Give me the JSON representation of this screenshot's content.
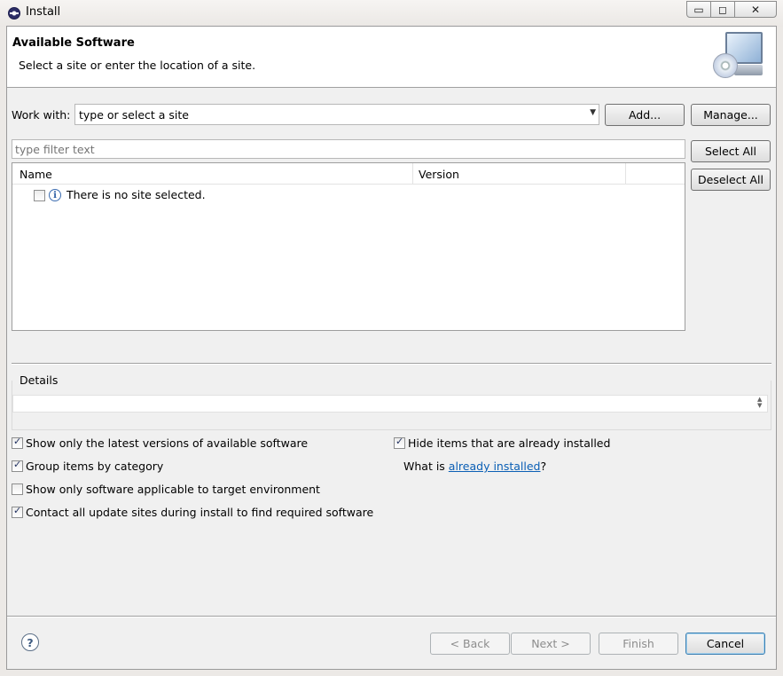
{
  "window": {
    "title": "Install",
    "min": "▭",
    "max": "◻",
    "close": "✕"
  },
  "header": {
    "title": "Available Software",
    "description": "Select a site or enter the location of a site."
  },
  "work_with": {
    "label": "Work with:",
    "value": "type or select a site",
    "add": "Add...",
    "manage": "Manage..."
  },
  "filter": {
    "placeholder": "type filter text"
  },
  "table": {
    "columns": [
      "Name",
      "Version"
    ],
    "rows": [
      {
        "name": "There is no site selected."
      }
    ]
  },
  "side_buttons": {
    "select_all": "Select All",
    "deselect_all": "Deselect All"
  },
  "details": {
    "label": "Details"
  },
  "options": {
    "latest_versions": {
      "label": "Show only the latest versions of available software",
      "checked": true
    },
    "group_by_category": {
      "label": "Group items by category",
      "checked": true
    },
    "target_env": {
      "label": "Show only software applicable to target environment",
      "checked": false
    },
    "contact_sites": {
      "label": "Contact all update sites during install to find required software",
      "checked": true
    },
    "hide_installed": {
      "label": "Hide items that are already installed",
      "checked": true
    },
    "what_is": "What is",
    "already_installed": "already installed",
    "question_mark": "?"
  },
  "footer": {
    "back": "< Back",
    "next": "Next >",
    "finish": "Finish",
    "cancel": "Cancel",
    "help": "?"
  },
  "colors": {
    "link": "#0b5fb5",
    "accent": "#3c7fb1"
  },
  "icons": [
    "eclipse-icon",
    "monitor-cd-icon",
    "info-icon",
    "dropdown-arrow-icon",
    "help-icon"
  ]
}
